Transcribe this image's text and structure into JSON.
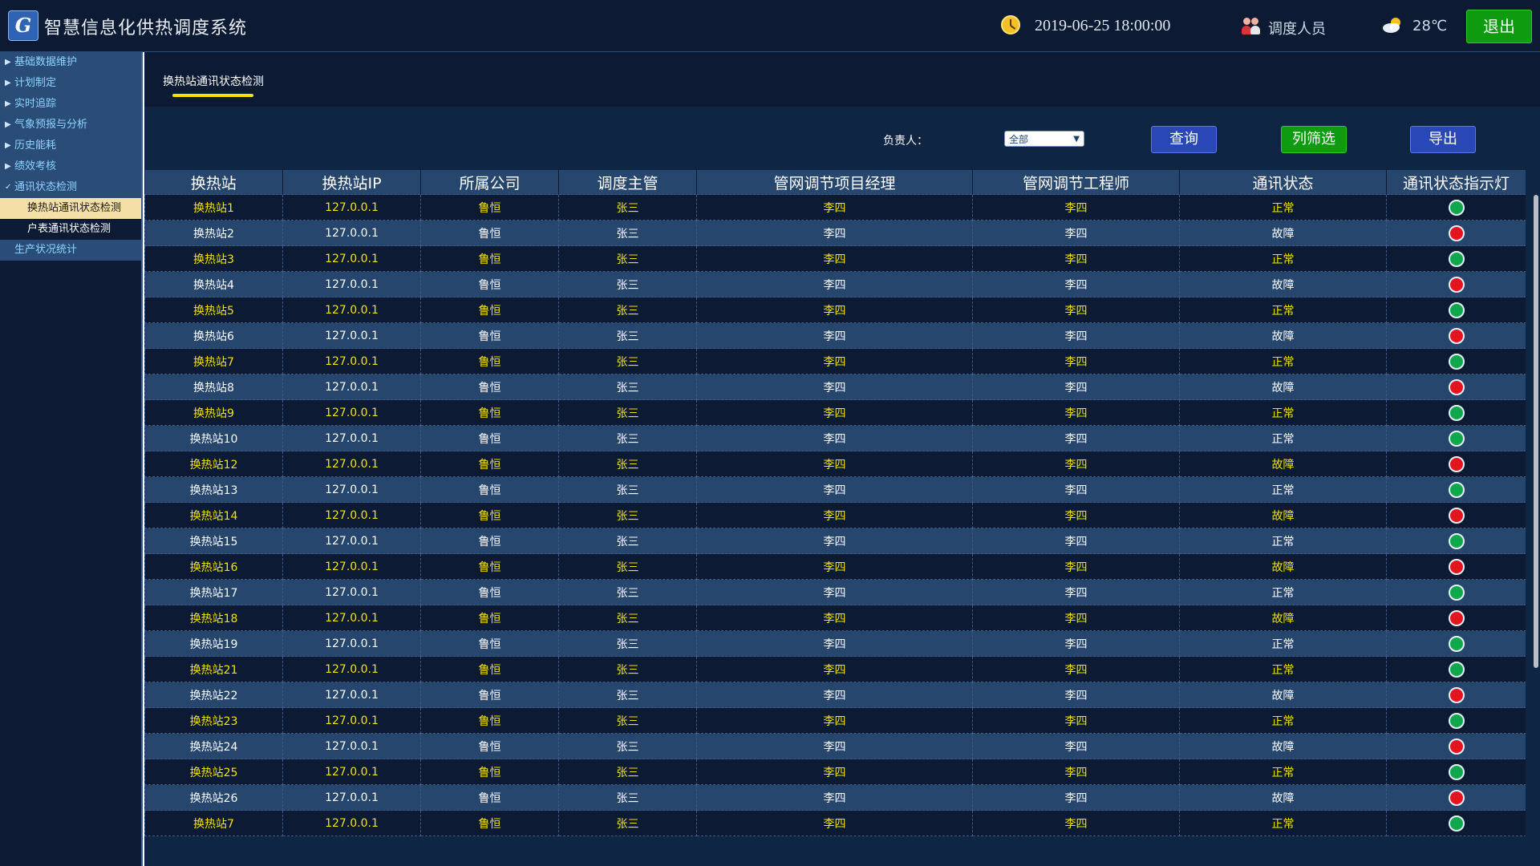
{
  "app": {
    "title": "智慧信息化供热调度系统",
    "logo_letter": "G"
  },
  "header": {
    "datetime": "2019-06-25 18:00:00",
    "user_role": "调度人员",
    "temperature": "28℃",
    "logout_label": "退出"
  },
  "sidebar": {
    "items": [
      {
        "label": "基础数据维护",
        "arrow": "▶"
      },
      {
        "label": "计划制定",
        "arrow": "▶"
      },
      {
        "label": "实时追踪",
        "arrow": "▶"
      },
      {
        "label": "气象预报与分析",
        "arrow": "▶"
      },
      {
        "label": "历史能耗",
        "arrow": "▶"
      },
      {
        "label": "绩效考核",
        "arrow": "▶"
      },
      {
        "label": "通讯状态检测",
        "arrow": "✓"
      }
    ],
    "sub_items": [
      {
        "label": "换热站通讯状态检测"
      },
      {
        "label": "户表通讯状态检测"
      }
    ],
    "last_item": {
      "label": "生产状况统计"
    }
  },
  "tab": {
    "label": "换热站通讯状态检测"
  },
  "filter": {
    "label": "负责人：",
    "selected": "全部"
  },
  "buttons": {
    "query": "查询",
    "column_filter": "列筛选",
    "export": "导出"
  },
  "table": {
    "columns": [
      "换热站",
      "换热站IP",
      "所属公司",
      "调度主管",
      "管网调节项目经理",
      "管网调节工程师",
      "通讯状态",
      "通讯状态指示灯"
    ],
    "rows": [
      {
        "station": "换热站1",
        "ip": "127.0.0.1",
        "company": "鲁恒",
        "supervisor": "张三",
        "manager": "李四",
        "engineer": "李四",
        "status": "正常",
        "light": "green"
      },
      {
        "station": "换热站2",
        "ip": "127.0.0.1",
        "company": "鲁恒",
        "supervisor": "张三",
        "manager": "李四",
        "engineer": "李四",
        "status": "故障",
        "light": "red"
      },
      {
        "station": "换热站3",
        "ip": "127.0.0.1",
        "company": "鲁恒",
        "supervisor": "张三",
        "manager": "李四",
        "engineer": "李四",
        "status": "正常",
        "light": "green"
      },
      {
        "station": "换热站4",
        "ip": "127.0.0.1",
        "company": "鲁恒",
        "supervisor": "张三",
        "manager": "李四",
        "engineer": "李四",
        "status": "故障",
        "light": "red"
      },
      {
        "station": "换热站5",
        "ip": "127.0.0.1",
        "company": "鲁恒",
        "supervisor": "张三",
        "manager": "李四",
        "engineer": "李四",
        "status": "正常",
        "light": "green"
      },
      {
        "station": "换热站6",
        "ip": "127.0.0.1",
        "company": "鲁恒",
        "supervisor": "张三",
        "manager": "李四",
        "engineer": "李四",
        "status": "故障",
        "light": "red"
      },
      {
        "station": "换热站7",
        "ip": "127.0.0.1",
        "company": "鲁恒",
        "supervisor": "张三",
        "manager": "李四",
        "engineer": "李四",
        "status": "正常",
        "light": "green"
      },
      {
        "station": "换热站8",
        "ip": "127.0.0.1",
        "company": "鲁恒",
        "supervisor": "张三",
        "manager": "李四",
        "engineer": "李四",
        "status": "故障",
        "light": "red"
      },
      {
        "station": "换热站9",
        "ip": "127.0.0.1",
        "company": "鲁恒",
        "supervisor": "张三",
        "manager": "李四",
        "engineer": "李四",
        "status": "正常",
        "light": "green"
      },
      {
        "station": "换热站10",
        "ip": "127.0.0.1",
        "company": "鲁恒",
        "supervisor": "张三",
        "manager": "李四",
        "engineer": "李四",
        "status": "正常",
        "light": "green"
      },
      {
        "station": "换热站12",
        "ip": "127.0.0.1",
        "company": "鲁恒",
        "supervisor": "张三",
        "manager": "李四",
        "engineer": "李四",
        "status": "故障",
        "light": "red"
      },
      {
        "station": "换热站13",
        "ip": "127.0.0.1",
        "company": "鲁恒",
        "supervisor": "张三",
        "manager": "李四",
        "engineer": "李四",
        "status": "正常",
        "light": "green"
      },
      {
        "station": "换热站14",
        "ip": "127.0.0.1",
        "company": "鲁恒",
        "supervisor": "张三",
        "manager": "李四",
        "engineer": "李四",
        "status": "故障",
        "light": "red"
      },
      {
        "station": "换热站15",
        "ip": "127.0.0.1",
        "company": "鲁恒",
        "supervisor": "张三",
        "manager": "李四",
        "engineer": "李四",
        "status": "正常",
        "light": "green"
      },
      {
        "station": "换热站16",
        "ip": "127.0.0.1",
        "company": "鲁恒",
        "supervisor": "张三",
        "manager": "李四",
        "engineer": "李四",
        "status": "故障",
        "light": "red"
      },
      {
        "station": "换热站17",
        "ip": "127.0.0.1",
        "company": "鲁恒",
        "supervisor": "张三",
        "manager": "李四",
        "engineer": "李四",
        "status": "正常",
        "light": "green"
      },
      {
        "station": "换热站18",
        "ip": "127.0.0.1",
        "company": "鲁恒",
        "supervisor": "张三",
        "manager": "李四",
        "engineer": "李四",
        "status": "故障",
        "light": "red"
      },
      {
        "station": "换热站19",
        "ip": "127.0.0.1",
        "company": "鲁恒",
        "supervisor": "张三",
        "manager": "李四",
        "engineer": "李四",
        "status": "正常",
        "light": "green"
      },
      {
        "station": "换热站21",
        "ip": "127.0.0.1",
        "company": "鲁恒",
        "supervisor": "张三",
        "manager": "李四",
        "engineer": "李四",
        "status": "正常",
        "light": "green"
      },
      {
        "station": "换热站22",
        "ip": "127.0.0.1",
        "company": "鲁恒",
        "supervisor": "张三",
        "manager": "李四",
        "engineer": "李四",
        "status": "故障",
        "light": "red"
      },
      {
        "station": "换热站23",
        "ip": "127.0.0.1",
        "company": "鲁恒",
        "supervisor": "张三",
        "manager": "李四",
        "engineer": "李四",
        "status": "正常",
        "light": "green"
      },
      {
        "station": "换热站24",
        "ip": "127.0.0.1",
        "company": "鲁恒",
        "supervisor": "张三",
        "manager": "李四",
        "engineer": "李四",
        "status": "故障",
        "light": "red"
      },
      {
        "station": "换热站25",
        "ip": "127.0.0.1",
        "company": "鲁恒",
        "supervisor": "张三",
        "manager": "李四",
        "engineer": "李四",
        "status": "正常",
        "light": "green"
      },
      {
        "station": "换热站26",
        "ip": "127.0.0.1",
        "company": "鲁恒",
        "supervisor": "张三",
        "manager": "李四",
        "engineer": "李四",
        "status": "故障",
        "light": "red"
      },
      {
        "station": "换热站7",
        "ip": "127.0.0.1",
        "company": "鲁恒",
        "supervisor": "张三",
        "manager": "李四",
        "engineer": "李四",
        "status": "正常",
        "light": "green"
      }
    ]
  },
  "colors": {
    "dark_bg": "#0c1a33",
    "row_alt": "#27466e",
    "highlight_text": "#f2e400",
    "ok_light": "#0fa84a",
    "fault_light": "#e3141e",
    "accent_green": "#0f9b0f",
    "accent_blue": "#2a47b8"
  }
}
